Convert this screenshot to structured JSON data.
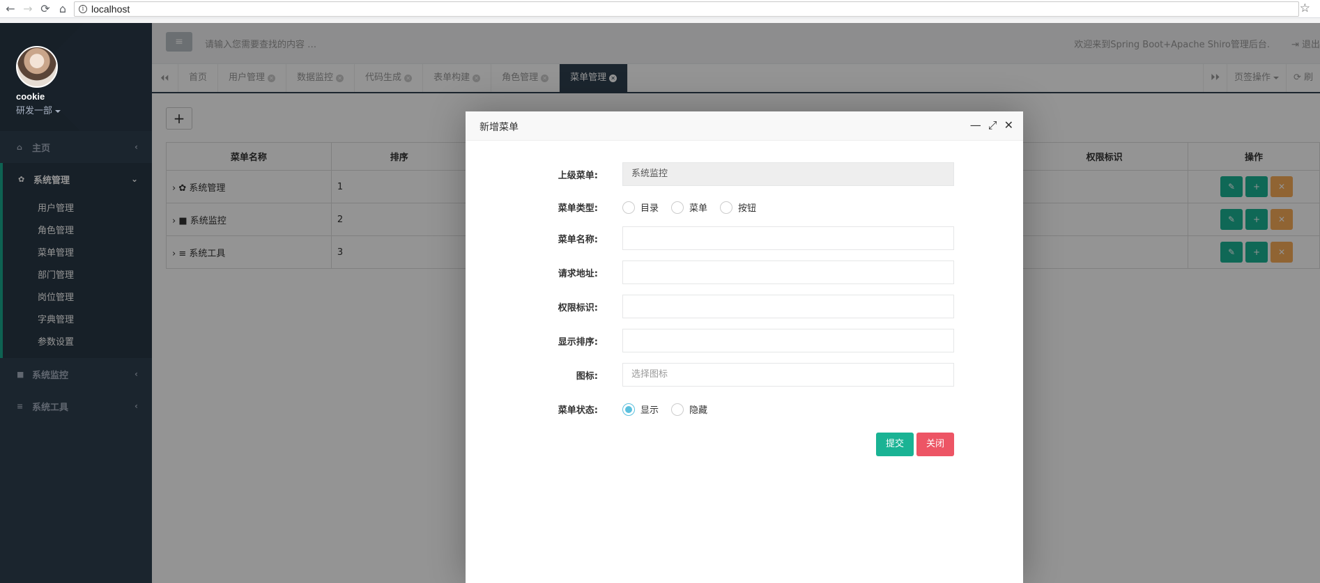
{
  "browser": {
    "url": "localhost",
    "back": "←",
    "forward": "→",
    "reload": "⟳",
    "home": "⌂",
    "info": "i",
    "star": "☆"
  },
  "sidebar": {
    "user_name": "cookie",
    "user_dept": "研发一部",
    "menu": {
      "home": "主页",
      "system": "系统管理",
      "monitor": "系统监控",
      "tools": "系统工具"
    },
    "submenu": [
      "用户管理",
      "角色管理",
      "菜单管理",
      "部门管理",
      "岗位管理",
      "字典管理",
      "参数设置"
    ]
  },
  "topbar": {
    "search_placeholder": "请输入您需要查找的内容 …",
    "welcome": "欢迎来到Spring Boot+Apache Shiro管理后台.",
    "logout": "退出"
  },
  "tabs": [
    {
      "label": "首页"
    },
    {
      "label": "用户管理"
    },
    {
      "label": "数据监控"
    },
    {
      "label": "代码生成"
    },
    {
      "label": "表单构建"
    },
    {
      "label": "角色管理"
    },
    {
      "label": "菜单管理"
    }
  ],
  "tab_tools": {
    "page_ops": "页签操作",
    "refresh": "刷"
  },
  "table": {
    "headers": [
      "菜单名称",
      "排序",
      "权限标识",
      "操作"
    ],
    "rows": [
      {
        "name": "系统管理",
        "order": "1"
      },
      {
        "name": "系统监控",
        "order": "2"
      },
      {
        "name": "系统工具",
        "order": "3"
      }
    ]
  },
  "modal": {
    "title": "新增菜单",
    "fields": {
      "parent_label": "上级菜单:",
      "parent_value": "系统监控",
      "type_label": "菜单类型:",
      "type_options": [
        "目录",
        "菜单",
        "按钮"
      ],
      "name_label": "菜单名称:",
      "url_label": "请求地址:",
      "perms_label": "权限标识:",
      "order_label": "显示排序:",
      "icon_label": "图标:",
      "icon_placeholder": "选择图标",
      "status_label": "菜单状态:",
      "status_options": [
        "显示",
        "隐藏"
      ]
    },
    "submit": "提交",
    "close": "关闭"
  },
  "colors": {
    "sidebar_bg": "#2f4050",
    "accent": "#1ab394",
    "danger": "#ed5565",
    "warning": "#f8ac59",
    "radio_on": "#5bc0de"
  }
}
